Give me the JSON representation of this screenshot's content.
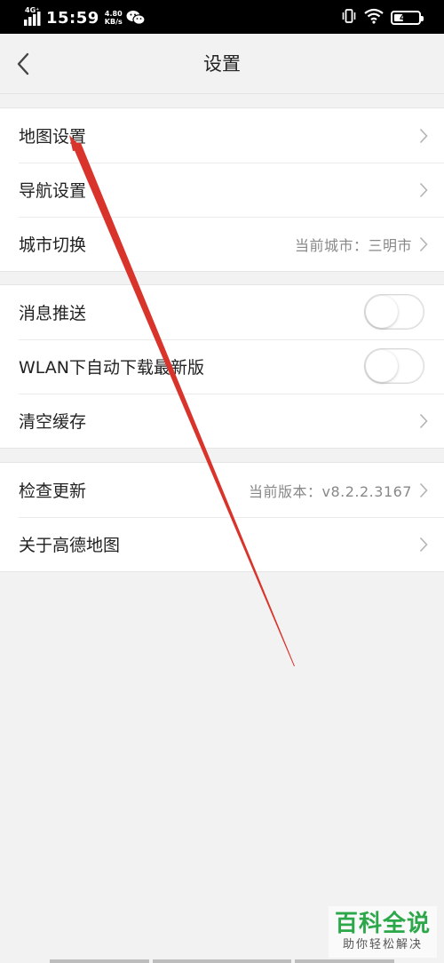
{
  "status_bar": {
    "network_type": "4G⁺",
    "time": "15:59",
    "net_speed_value": "4.80",
    "net_speed_unit": "KB/s",
    "battery_level": "46"
  },
  "header": {
    "title": "设置"
  },
  "group1": {
    "items": [
      {
        "label": "地图设置",
        "value": ""
      },
      {
        "label": "导航设置",
        "value": ""
      },
      {
        "label": "城市切换",
        "value": "当前城市：三明市"
      }
    ]
  },
  "group2": {
    "items": [
      {
        "label": "消息推送",
        "toggle_on": false
      },
      {
        "label": "WLAN下自动下载最新版",
        "toggle_on": false
      },
      {
        "label": "清空缓存",
        "value": ""
      }
    ]
  },
  "group3": {
    "items": [
      {
        "label": "检查更新",
        "value": "当前版本：v8.2.2.3167"
      },
      {
        "label": "关于高德地图",
        "value": ""
      }
    ]
  },
  "watermark": {
    "title": "百科全说",
    "subtitle": "助你轻松解决"
  },
  "colors": {
    "annotation_arrow": "#d9342b",
    "watermark_green": "#2ca84b"
  }
}
